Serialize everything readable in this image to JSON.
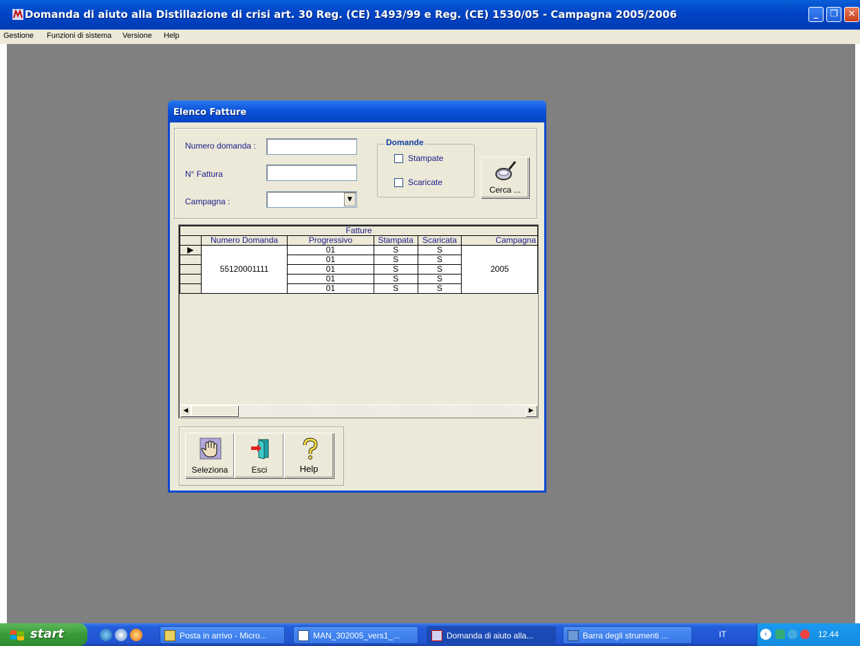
{
  "window": {
    "title": "Domanda di aiuto alla Distillazione di crisi art. 30 Reg. (CE) 1493/99 e Reg. (CE) 1530/05 - Campagna 2005/2006",
    "min_glyph": "_",
    "max_glyph": "❐",
    "close_glyph": "✕"
  },
  "menu": [
    "Gestione",
    "Funzioni di sistema",
    "Versione",
    "Help"
  ],
  "dialog": {
    "title": "Elenco  Fatture",
    "filters": {
      "numero_domanda_label": "Numero domanda :",
      "numero_domanda_value": "",
      "fattura_label": "N° Fattura",
      "fattura_value": "",
      "campagna_label": "Campagna :",
      "campagna_value": "",
      "combo_arrow": "▼"
    },
    "domande": {
      "legend": "Domande",
      "stampate_label": "Stampate",
      "stampate_checked": false,
      "scaricate_label": "Scaricate",
      "scaricate_checked": false
    },
    "search_button": "Cerca ...",
    "grid": {
      "caption": "Fatture",
      "columns": [
        "Numero Domanda",
        "Progressivo",
        "Stampata",
        "Scaricata",
        "Campagna"
      ],
      "numero_domanda": "55120001111",
      "campagna": "2005",
      "rows": [
        {
          "progressivo": "01",
          "stampata": "S",
          "scaricata": "S"
        },
        {
          "progressivo": "01",
          "stampata": "S",
          "scaricata": "S"
        },
        {
          "progressivo": "01",
          "stampata": "S",
          "scaricata": "S"
        },
        {
          "progressivo": "01",
          "stampata": "S",
          "scaricata": "S"
        },
        {
          "progressivo": "01",
          "stampata": "S",
          "scaricata": "S"
        }
      ],
      "row_indicator": "▶",
      "scroll_left": "◀",
      "scroll_right": "▶"
    },
    "buttons": {
      "seleziona": "Seleziona",
      "esci": "Esci",
      "help": "Help"
    }
  },
  "taskbar": {
    "start": "start",
    "tasks": [
      {
        "label": "Posta in arrivo - Micro...",
        "icon": "outlook-icon"
      },
      {
        "label": "MAN_302005_vers1_...",
        "icon": "word-icon"
      },
      {
        "label": "Domanda di aiuto alla...",
        "icon": "app-icon"
      },
      {
        "label": "Barra degli strumenti ...",
        "icon": "toolbar-app-icon"
      }
    ],
    "lang": "IT",
    "clock": "12.44"
  },
  "colors": {
    "titlebar": "#0046c8",
    "desktop": "#808080",
    "dialog_bg": "#ece9d8",
    "taskbar": "#245edb",
    "start": "#3a9a3a"
  }
}
